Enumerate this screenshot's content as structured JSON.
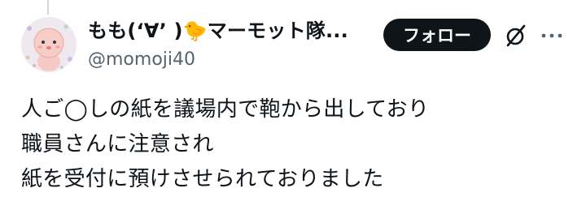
{
  "author": {
    "display_name": "もも(‘∀’ )🐤マーモット隊...",
    "handle": "@momoji40"
  },
  "actions": {
    "follow_label": "フォロー",
    "grok_icon": "grok-slash-icon",
    "more_icon": "more-dots-icon"
  },
  "tweet": {
    "lines": [
      "人ご◯しの紙を議場内で鞄から出しており",
      "職員さんに注意され",
      "紙を受付に預けさせられておりました"
    ]
  },
  "colors": {
    "text": "#0f1419",
    "secondary_text": "#536471",
    "follow_button_bg": "#0f1419",
    "avatar_bg": "#efe8ef"
  }
}
